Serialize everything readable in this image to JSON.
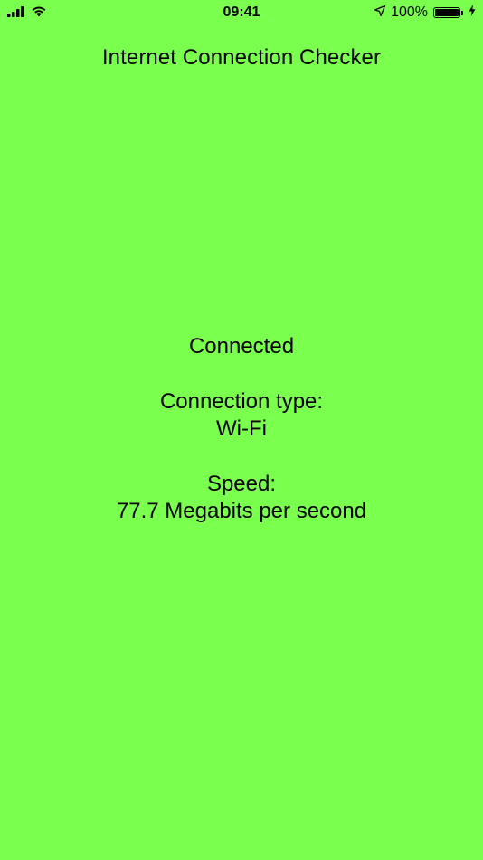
{
  "status_bar": {
    "time": "09:41",
    "battery_percent": "100%",
    "battery_level": 1.0,
    "icons": [
      "cellular-signal-icon",
      "wifi-icon",
      "location-arrow-icon",
      "battery-icon",
      "charging-bolt-icon"
    ]
  },
  "header": {
    "title": "Internet Connection Checker"
  },
  "status": {
    "connection_state": "Connected",
    "connection_type_label": "Connection type:",
    "connection_type_value": "Wi-Fi",
    "speed_label": "Speed:",
    "speed_value": "77.7 Megabits per second"
  },
  "colors": {
    "background": "#7AFF4E",
    "text": "#000000"
  }
}
